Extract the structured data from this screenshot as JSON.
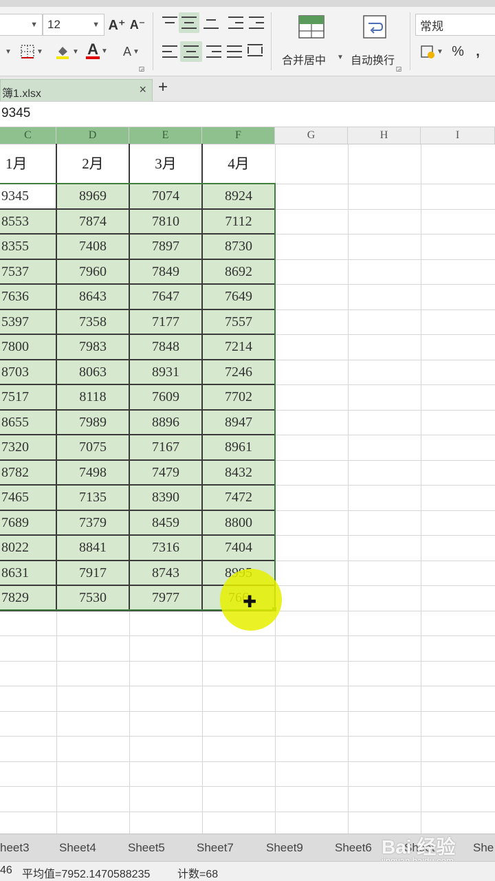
{
  "ribbon": {
    "font_size": "12",
    "number_format": "常规",
    "merge_center_label": "合并居中",
    "wrap_text_label": "自动换行",
    "grow_font_icon": "A⁺",
    "shrink_font_icon": "A⁻",
    "font_color_letter": "A",
    "percent_symbol": "%",
    "accent": "#cfe1cf"
  },
  "tabs": {
    "file_name": "簿1.xlsx",
    "close_glyph": "×",
    "new_tab_glyph": "+"
  },
  "formula_bar": {
    "value": "9345"
  },
  "columns": [
    "C",
    "D",
    "E",
    "F",
    "G",
    "H",
    "I"
  ],
  "table": {
    "headers": [
      "1月",
      "2月",
      "3月",
      "4月"
    ],
    "rows": [
      [
        "9345",
        "8969",
        "7074",
        "8924"
      ],
      [
        "8553",
        "7874",
        "7810",
        "7112"
      ],
      [
        "8355",
        "7408",
        "7897",
        "8730"
      ],
      [
        "7537",
        "7960",
        "7849",
        "8692"
      ],
      [
        "7636",
        "8643",
        "7647",
        "7649"
      ],
      [
        "5397",
        "7358",
        "7177",
        "7557"
      ],
      [
        "7800",
        "7983",
        "7848",
        "7214"
      ],
      [
        "8703",
        "8063",
        "8931",
        "7246"
      ],
      [
        "7517",
        "8118",
        "7609",
        "7702"
      ],
      [
        "8655",
        "7989",
        "8896",
        "8947"
      ],
      [
        "7320",
        "7075",
        "7167",
        "8961"
      ],
      [
        "8782",
        "7498",
        "7479",
        "8432"
      ],
      [
        "7465",
        "7135",
        "8390",
        "7472"
      ],
      [
        "7689",
        "7379",
        "8459",
        "8800"
      ],
      [
        "8022",
        "8841",
        "7316",
        "7404"
      ],
      [
        "8631",
        "7917",
        "8743",
        "8995"
      ],
      [
        "7829",
        "7530",
        "7977",
        "766"
      ]
    ],
    "selection_color": "#d6e8cd",
    "selection_border": "#3f7f3f"
  },
  "sheets": [
    "heet3",
    "Sheet4",
    "Sheet5",
    "Sheet7",
    "Sheet9",
    "Sheet6",
    "Sheet",
    "She"
  ],
  "watermark": {
    "brand": "Bai 经验",
    "url": "jingyan.baidu.com"
  },
  "status": {
    "sum_fragment": "46",
    "average": "平均值=7952.1470588235",
    "count": "计数=68"
  }
}
